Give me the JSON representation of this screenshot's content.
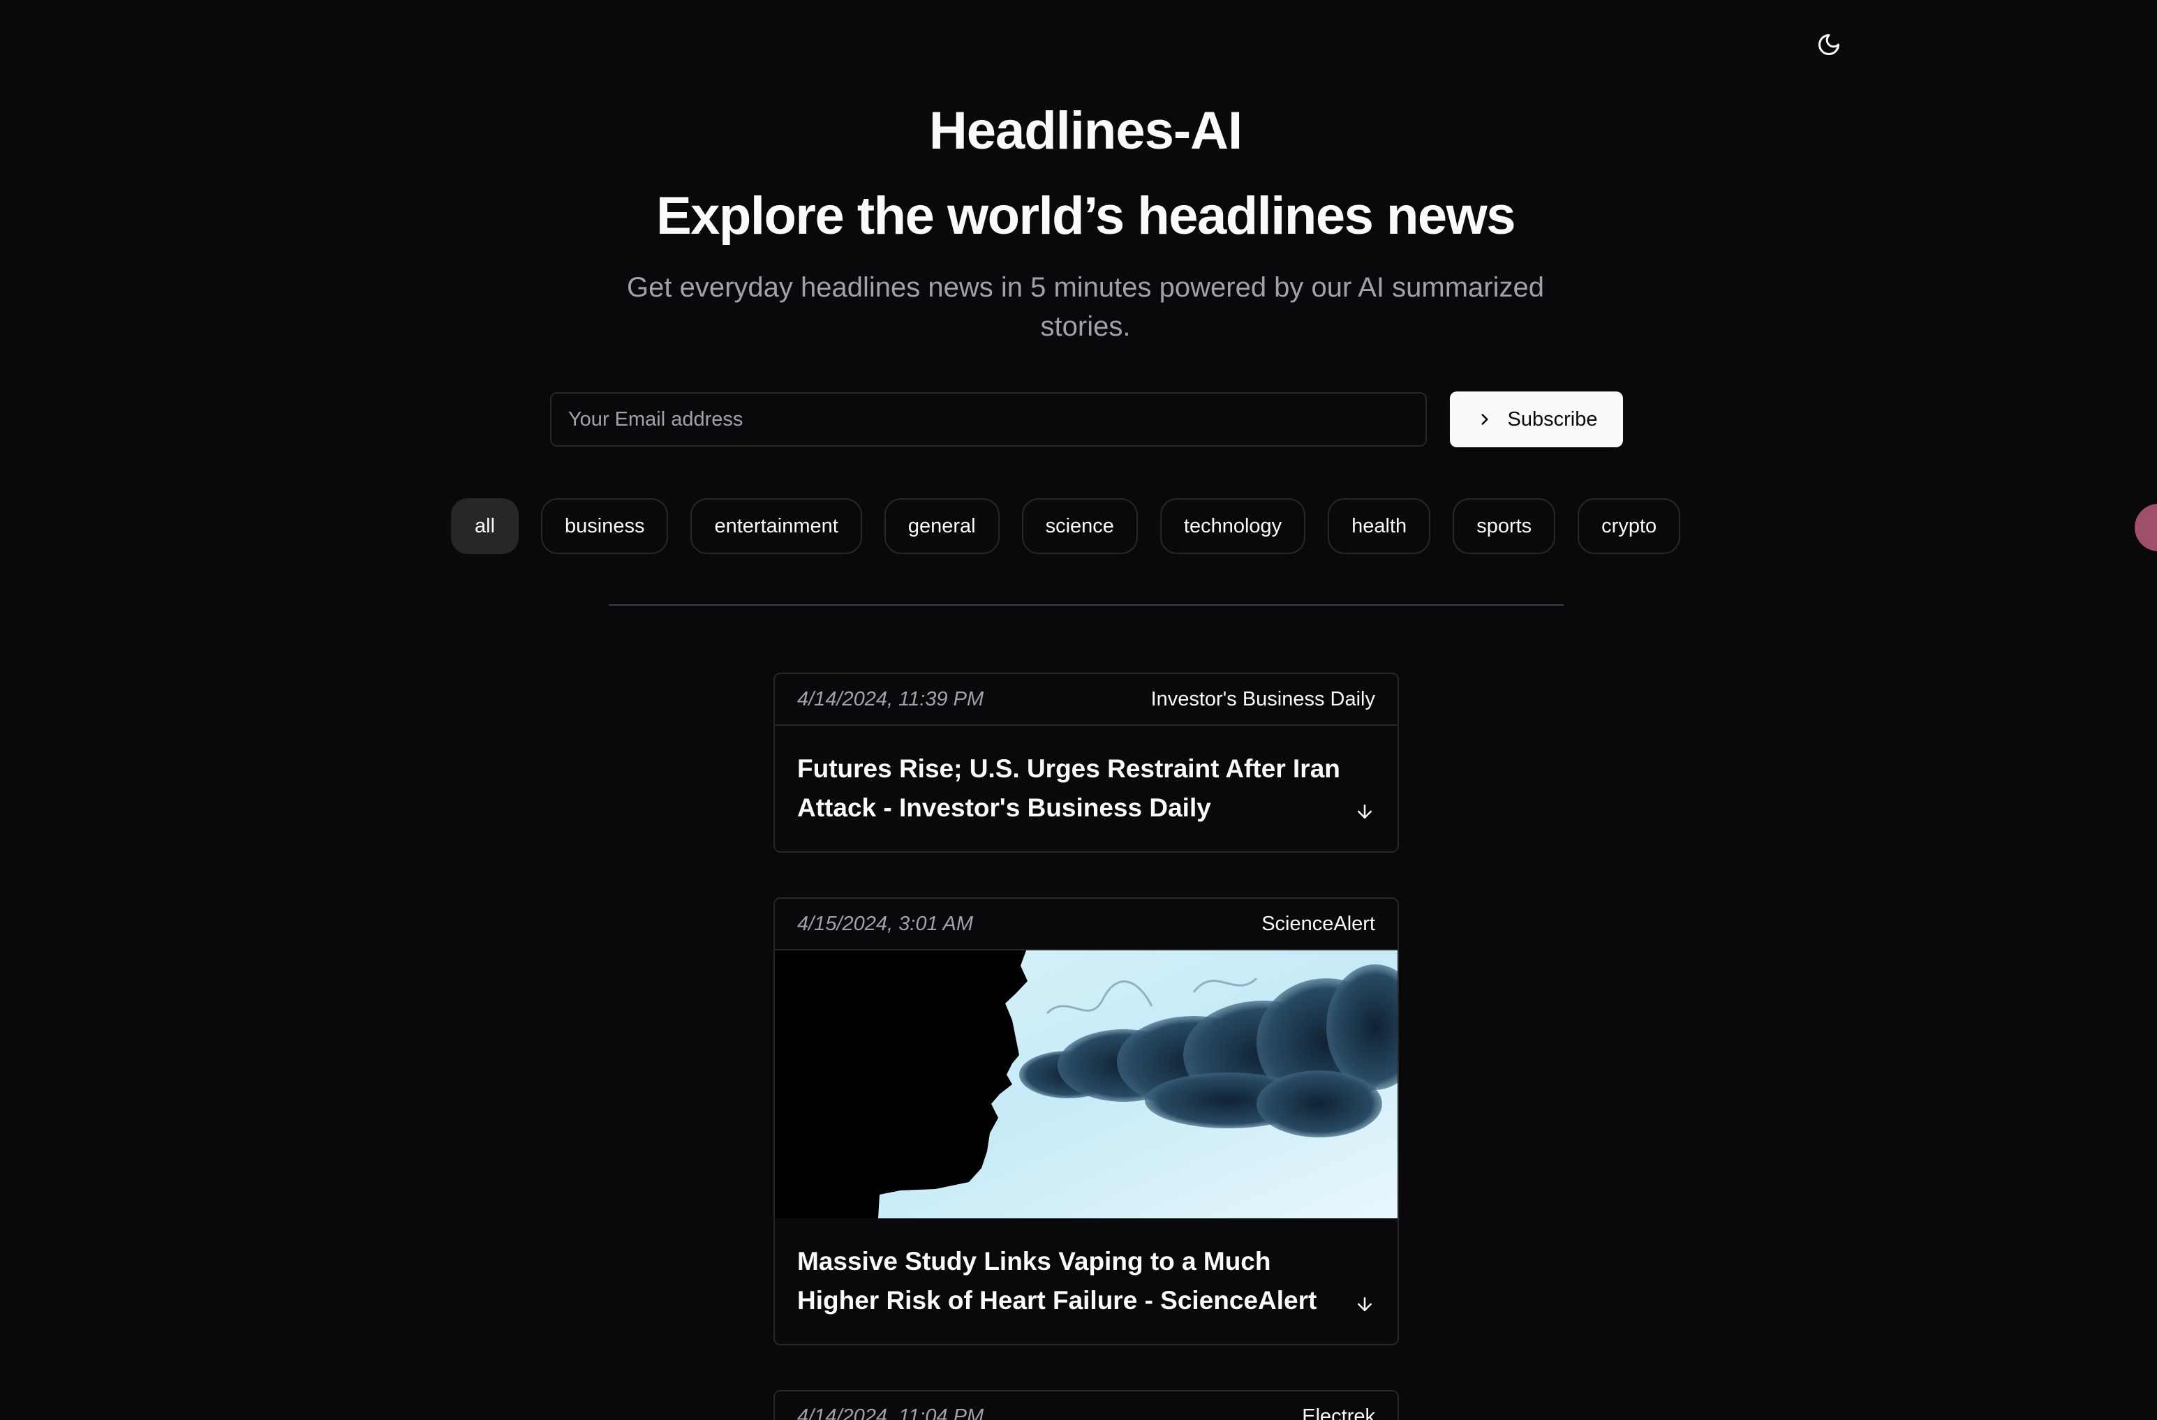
{
  "header": {
    "app_title": "Headlines-AI",
    "theme_toggle_icon": "moon-icon"
  },
  "hero": {
    "title": "Explore the world’s headlines news",
    "subtitle": "Get everyday headlines news in 5 minutes powered by our AI summarized stories."
  },
  "subscribe": {
    "email_placeholder": "Your Email address",
    "email_value": "",
    "button_label": "Subscribe",
    "button_icon": "chevron-right-icon"
  },
  "categories": {
    "active": "all",
    "items": [
      "all",
      "business",
      "entertainment",
      "general",
      "science",
      "technology",
      "health",
      "sports",
      "crypto"
    ]
  },
  "articles": [
    {
      "date": "4/14/2024, 11:39 PM",
      "source": "Investor's Business Daily",
      "title": "Futures Rise; U.S. Urges Restraint After Iran Attack - Investor's Business Daily",
      "has_image": false
    },
    {
      "date": "4/15/2024, 3:01 AM",
      "source": "ScienceAlert",
      "title": "Massive Study Links Vaping to a Much Higher Risk of Heart Failure - ScienceAlert",
      "has_image": true
    },
    {
      "date": "4/14/2024, 11:04 PM",
      "source": "Electrek",
      "title": "",
      "has_image": false
    }
  ],
  "colors": {
    "background": "#09090b",
    "border": "#27272a",
    "muted_text": "#a1a1aa",
    "foreground": "#fafafa",
    "avatar": "#9f4f6b"
  }
}
